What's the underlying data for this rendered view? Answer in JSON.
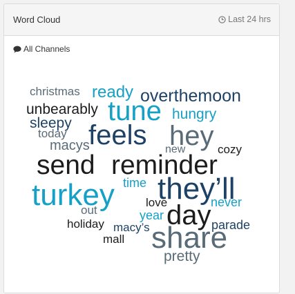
{
  "panel": {
    "title": "Word Cloud",
    "time_range": "Last 24 hrs",
    "channel": "All Channels"
  },
  "icons": {
    "time": "clock-icon",
    "channel": "comment-icon"
  },
  "colors": {
    "dark_navy": "#1e4166",
    "mid_blue": "#2e6a99",
    "light_blue": "#16a0c6",
    "slate": "#5a6b78",
    "black": "#1c1c1c"
  },
  "words": [
    {
      "text": "christmas",
      "color": "#5a6b78"
    },
    {
      "text": "ready",
      "color": "#16a0c6"
    },
    {
      "text": "overthemoon",
      "color": "#1e4166"
    },
    {
      "text": "unbearably",
      "color": "#1c1c1c"
    },
    {
      "text": "tune",
      "color": "#16a0c6"
    },
    {
      "text": "hungry",
      "color": "#16a0c6"
    },
    {
      "text": "sleepy",
      "color": "#1e4166"
    },
    {
      "text": "today",
      "color": "#5a6b78"
    },
    {
      "text": "feels",
      "color": "#1e4166"
    },
    {
      "text": "hey",
      "color": "#5a6b78"
    },
    {
      "text": "macys",
      "color": "#5a6b78"
    },
    {
      "text": "new",
      "color": "#5a6b78"
    },
    {
      "text": "cozy",
      "color": "#1c1c1c"
    },
    {
      "text": "send",
      "color": "#1c1c1c"
    },
    {
      "text": "reminder",
      "color": "#1c1c1c"
    },
    {
      "text": "turkey",
      "color": "#16a0c6"
    },
    {
      "text": "time",
      "color": "#16a0c6"
    },
    {
      "text": "they’ll",
      "color": "#1e4166"
    },
    {
      "text": "love",
      "color": "#1c1c1c"
    },
    {
      "text": "never",
      "color": "#16a0c6"
    },
    {
      "text": "out",
      "color": "#5a6b78"
    },
    {
      "text": "year",
      "color": "#16a0c6"
    },
    {
      "text": "day",
      "color": "#1c1c1c"
    },
    {
      "text": "holiday",
      "color": "#1c1c1c"
    },
    {
      "text": "macy’s",
      "color": "#1e4166"
    },
    {
      "text": "parade",
      "color": "#1e4166"
    },
    {
      "text": "mall",
      "color": "#1c1c1c"
    },
    {
      "text": "share",
      "color": "#5a6b78"
    },
    {
      "text": "pretty",
      "color": "#5a6b78"
    }
  ]
}
